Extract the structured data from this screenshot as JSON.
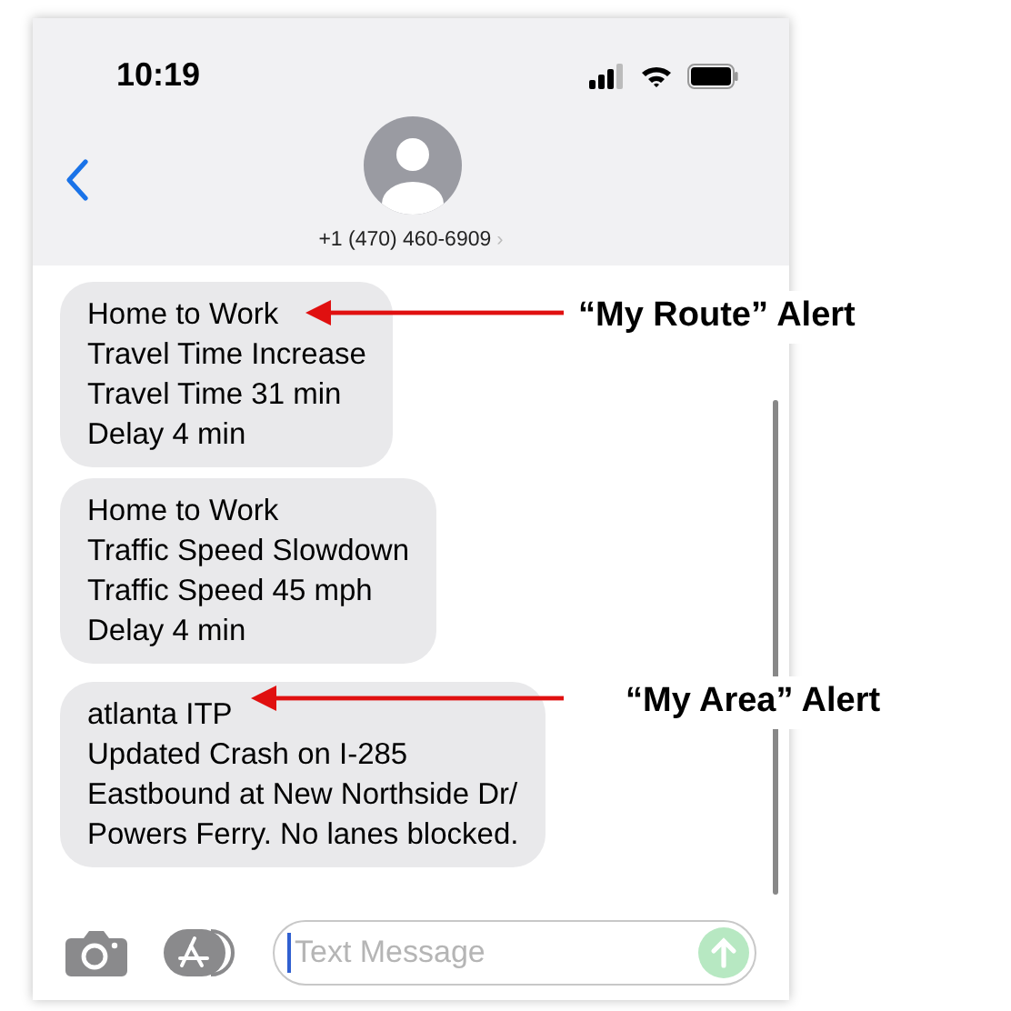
{
  "status_bar": {
    "time": "10:19"
  },
  "contact": {
    "phone": "+1 (470) 460-6909",
    "chevron": "›"
  },
  "messages": [
    {
      "lines": [
        "Home to Work",
        "Travel Time Increase",
        "Travel Time 31 min",
        "Delay 4 min"
      ],
      "annotation": "“My Route” Alert"
    },
    {
      "lines": [
        "Home to Work",
        "Traffic Speed Slowdown",
        "Traffic Speed 45 mph",
        "Delay 4 min"
      ]
    },
    {
      "lines": [
        "atlanta ITP",
        "Updated Crash on I-285",
        "Eastbound at New Northside Dr/",
        "Powers Ferry. No lanes blocked."
      ],
      "annotation": "“My Area” Alert"
    }
  ],
  "composer": {
    "placeholder": "Text Message"
  }
}
